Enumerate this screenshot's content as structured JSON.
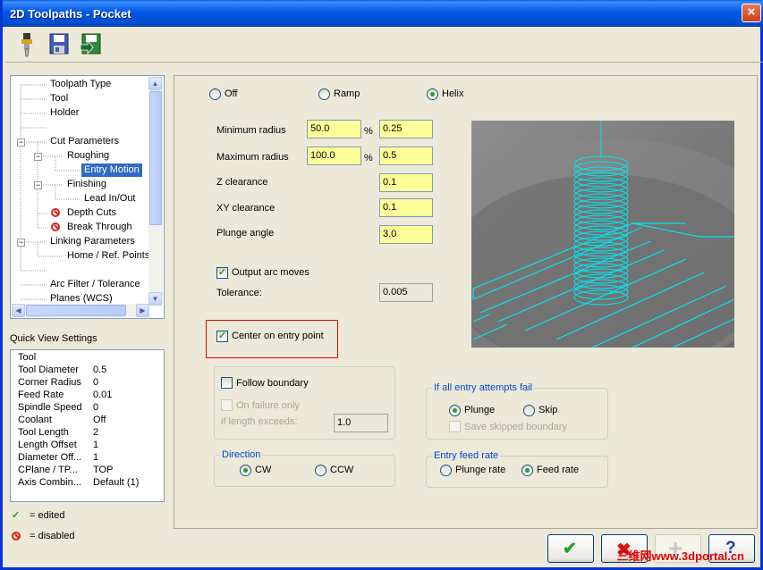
{
  "window": {
    "title": "2D Toolpaths - Pocket",
    "close_icon": "×"
  },
  "toolbar": {
    "icons": [
      "tool-holder-icon",
      "save-icon",
      "save-as-icon"
    ]
  },
  "tree": {
    "items": [
      {
        "label": "Toolpath Type"
      },
      {
        "label": "Tool"
      },
      {
        "label": "Holder"
      },
      {
        "label": ""
      },
      {
        "label": "Cut Parameters"
      },
      {
        "label": "Roughing"
      },
      {
        "label": "Entry Motion"
      },
      {
        "label": "Finishing"
      },
      {
        "label": "Lead In/Out"
      },
      {
        "label": "Depth Cuts"
      },
      {
        "label": "Break Through"
      },
      {
        "label": "Linking Parameters"
      },
      {
        "label": "Home / Ref. Points"
      },
      {
        "label": ""
      },
      {
        "label": "Arc Filter / Tolerance"
      },
      {
        "label": "Planes (WCS)"
      }
    ],
    "selected": "Entry Motion"
  },
  "quick_view": {
    "label": "Quick View Settings",
    "rows": [
      {
        "key": "Tool",
        "value": ""
      },
      {
        "key": "Tool Diameter",
        "value": "0.5"
      },
      {
        "key": "Corner Radius",
        "value": "0"
      },
      {
        "key": "Feed Rate",
        "value": "0.01"
      },
      {
        "key": "Spindle Speed",
        "value": "0"
      },
      {
        "key": "Coolant",
        "value": "Off"
      },
      {
        "key": "Tool Length",
        "value": "2"
      },
      {
        "key": "Length Offset",
        "value": "1"
      },
      {
        "key": "Diameter Off...",
        "value": "1"
      },
      {
        "key": "CPlane / TP...",
        "value": "TOP"
      },
      {
        "key": "Axis Combin...",
        "value": "Default (1)"
      }
    ]
  },
  "legend": {
    "edited": "= edited",
    "disabled": "= disabled"
  },
  "entry_mode": {
    "off": "Off",
    "ramp": "Ramp",
    "helix": "Helix",
    "selected": "Helix"
  },
  "params": {
    "min_radius_label": "Minimum radius",
    "min_radius_pct": "50.0",
    "min_radius_val": "0.25",
    "max_radius_label": "Maximum radius",
    "max_radius_pct": "100.0",
    "max_radius_val": "0.5",
    "pct_symbol": "%",
    "z_clearance_label": "Z clearance",
    "z_clearance": "0.1",
    "xy_clearance_label": "XY clearance",
    "xy_clearance": "0.1",
    "plunge_angle_label": "Plunge angle",
    "plunge_angle": "3.0",
    "output_arc_label": "Output arc moves",
    "output_arc_checked": true,
    "tolerance_label": "Tolerance:",
    "tolerance": "0.005",
    "center_entry_label": "Center on entry point",
    "center_entry_checked": true
  },
  "follow": {
    "label": "Follow boundary",
    "on_failure_label": "On failure only",
    "if_length_label": "if length exceeds:",
    "length_value": "1.0"
  },
  "direction": {
    "title": "Direction",
    "cw": "CW",
    "ccw": "CCW",
    "selected": "CW"
  },
  "fail": {
    "title": "If all entry attempts fail",
    "plunge": "Plunge",
    "skip": "Skip",
    "selected": "Plunge",
    "save_skipped": "Save skipped boundary"
  },
  "feed": {
    "title": "Entry feed rate",
    "plunge_rate": "Plunge rate",
    "feed_rate": "Feed rate",
    "selected": "Feed rate"
  },
  "buttons": {
    "ok_icon": "✔",
    "cancel_icon": "✖",
    "add_icon": "+",
    "help_icon": "?"
  },
  "watermark": "三维网www.3dportal.cn",
  "colors": {
    "field_yellow": "#FFFF99",
    "helix_cyan": "#00E5F0",
    "group_title_blue": "#0046D5"
  }
}
